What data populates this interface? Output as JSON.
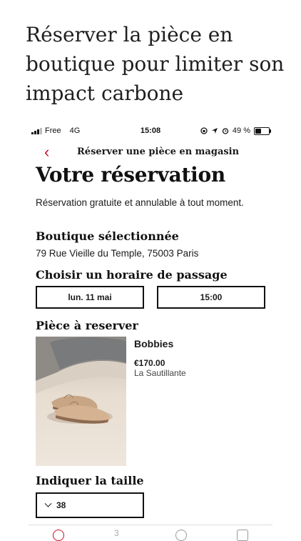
{
  "promo_heading": "Réserver la pièce en boutique pour limiter son impact carbone",
  "status_bar": {
    "carrier": "Free",
    "network": "4G",
    "time": "15:08",
    "battery": "49 %",
    "battery_level": 0.49
  },
  "nav": {
    "back_icon": "chevron-left-icon",
    "title": "Réserver une pièce en magasin"
  },
  "page_title": "Votre réservation",
  "lead_text": "Réservation gratuite et annulable à tout moment.",
  "shop": {
    "heading": "Boutique sélectionnée",
    "address": "79 Rue Vieille du Temple, 75003 Paris"
  },
  "slot": {
    "heading": "Choisir un horaire de passage",
    "date": "lun. 11 mai",
    "time": "15:00"
  },
  "piece": {
    "heading": "Pièce à reserver",
    "name": "Bobbies",
    "price": "€170.00",
    "brand": "La Sautillante"
  },
  "size": {
    "heading": "Indiquer la taille",
    "value": "38"
  },
  "tabbar": {
    "items": [
      "home-icon",
      "number-three-icon",
      "location-icon",
      "settings-icon"
    ]
  },
  "colors": {
    "accent": "#c8102e",
    "text": "#111111",
    "background": "#ffffff"
  }
}
